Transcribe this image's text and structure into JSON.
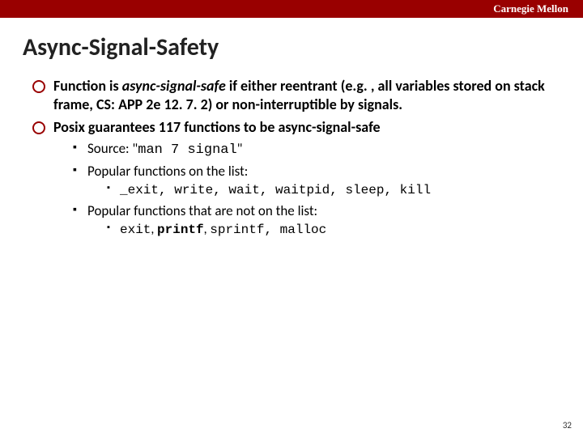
{
  "header": {
    "org": "Carnegie Mellon"
  },
  "title": "Async-Signal-Safety",
  "bullets": {
    "b1_pre": "Function is ",
    "b1_em": "async-signal-safe",
    "b1_post": " if either reentrant (e.g. , all variables stored on stack frame, CS: APP 2e 12. 7. 2) or non-interruptible by signals.",
    "b2": "Posix guarantees 117 functions to be async-signal-safe",
    "sub": {
      "s1_pre": "Source: \"",
      "s1_code": "man 7 signal",
      "s1_post": "\"",
      "s2": "Popular functions on the list:",
      "s2_code": "_exit, write, wait, waitpid, sleep, kill",
      "s3": "Popular functions that are not on the list:",
      "s3_c1": "exit",
      "s3_sep1": ", ",
      "s3_c2": "printf",
      "s3_sep2": ", ",
      "s3_c3": "sprintf, malloc"
    }
  },
  "pagenum": "32"
}
